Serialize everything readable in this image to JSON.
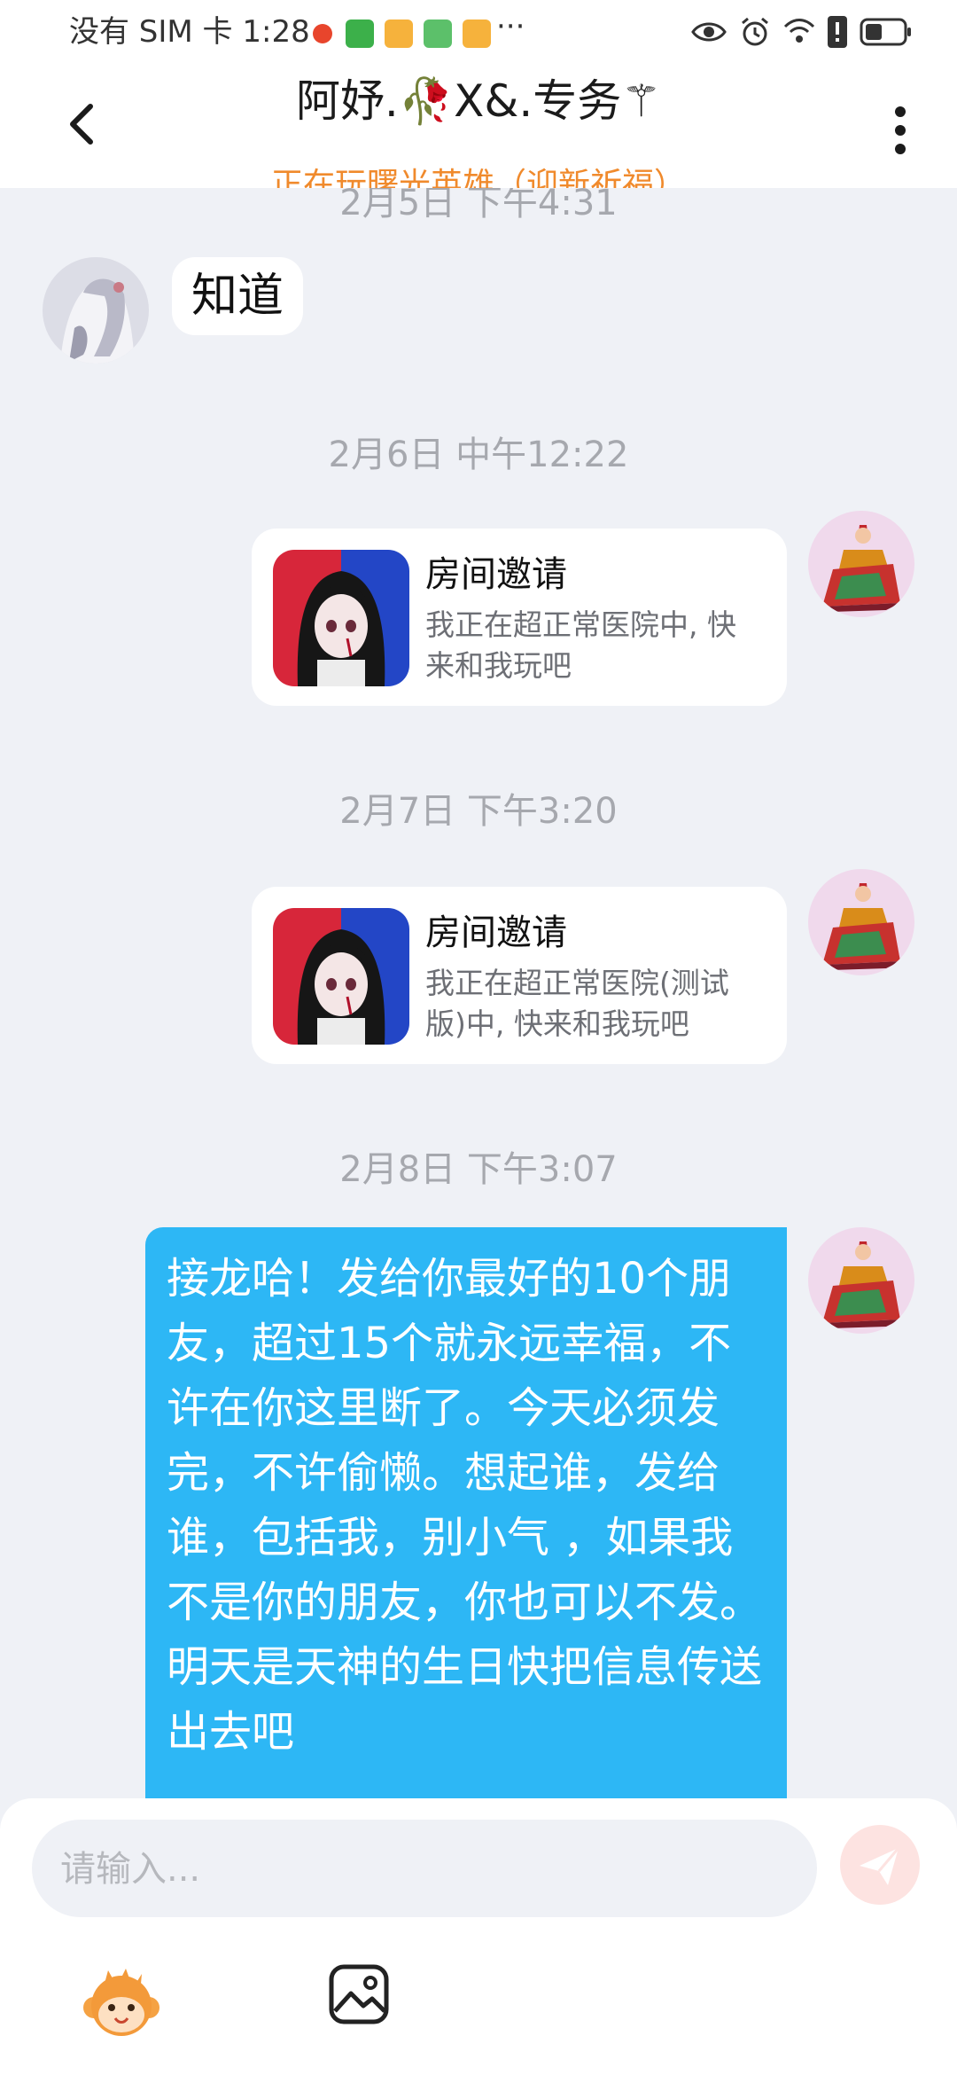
{
  "status_bar": {
    "carrier_time": "没有 SIM 卡 1:28",
    "more_notifications": "···"
  },
  "header": {
    "back_icon": "chevron-left-icon",
    "title": "阿妤.🥀X&.专务⚚",
    "status": "正在玩曙光英雄（迎新祈福）",
    "more_icon": "vertical-dots-icon"
  },
  "messages": [
    {
      "timestamp": "2月5日 下午4:31"
    },
    {
      "sender": "other",
      "type": "text",
      "text": "知道"
    },
    {
      "timestamp": "2月6日 中午12:22"
    },
    {
      "sender": "me",
      "type": "room_invite",
      "title": "房间邀请",
      "desc": "我正在超正常医院中, 快来和我玩吧"
    },
    {
      "timestamp": "2月7日 下午3:20"
    },
    {
      "sender": "me",
      "type": "room_invite",
      "title": "房间邀请",
      "desc": "我正在超正常医院(测试版)中, 快来和我玩吧"
    },
    {
      "timestamp": "2月8日 下午3:07"
    },
    {
      "sender": "me",
      "type": "text",
      "text": "接龙哈！发给你最好的10个朋友，超过15个就永远幸福，不许在你这里断了。今天必须发完，不许偷懒。想起谁，发给谁，包括我，别小气 ，如果我不是你的朋友，你也可以不发。明天是天神的生日快把信息传送出去吧"
    }
  ],
  "composer": {
    "placeholder": "请输入...",
    "send_icon": "send-plane-icon",
    "emoji_icon": "monkey-emoji-icon",
    "image_icon": "image-icon"
  },
  "colors": {
    "accent_blue": "#2db7f5",
    "status_orange": "#f08a2c",
    "background": "#eff1f6"
  }
}
